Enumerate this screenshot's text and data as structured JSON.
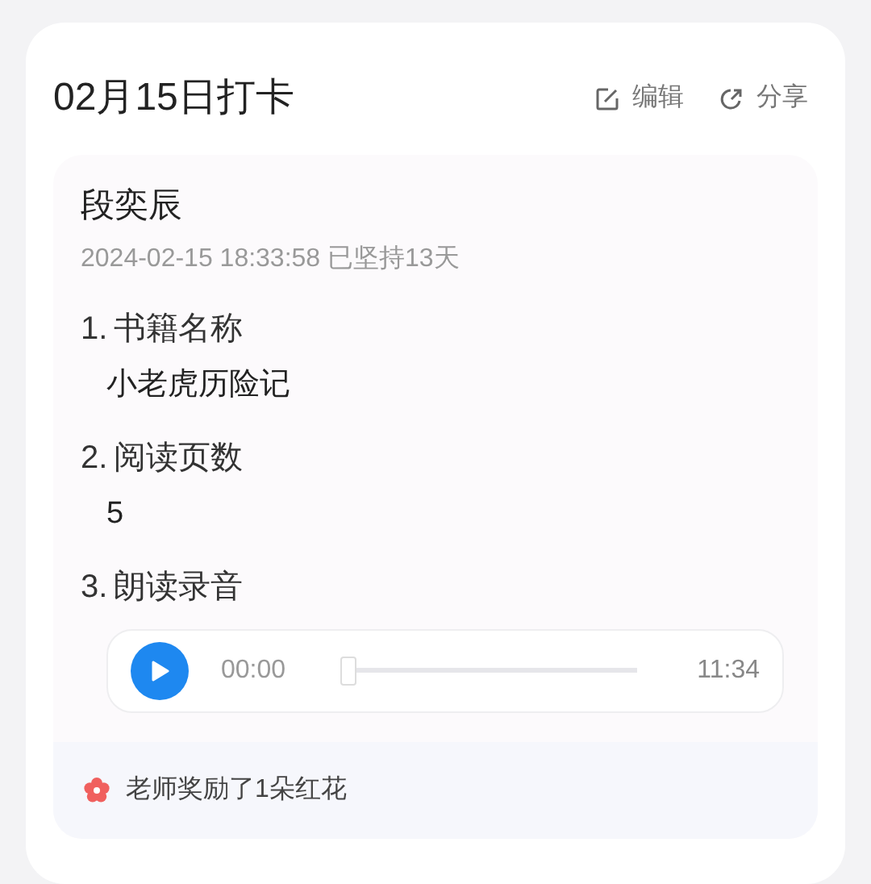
{
  "header": {
    "title": "02月15日打卡",
    "actions": [
      {
        "kind": "edit",
        "label": "编辑"
      },
      {
        "kind": "share",
        "label": "分享"
      }
    ]
  },
  "entry": {
    "name": "段奕辰",
    "meta": "2024-02-15 18:33:58 已坚持13天",
    "questions": [
      {
        "number": "1.",
        "label": "书籍名称",
        "kind": "text",
        "answer": "小老虎历险记"
      },
      {
        "number": "2.",
        "label": "阅读页数",
        "kind": "text",
        "answer": "5"
      },
      {
        "number": "3.",
        "label": "朗读录音",
        "kind": "audio",
        "current": "00:00",
        "duration": "11:34",
        "level": 0
      }
    ],
    "reward": "老师奖励了1朵红花"
  }
}
